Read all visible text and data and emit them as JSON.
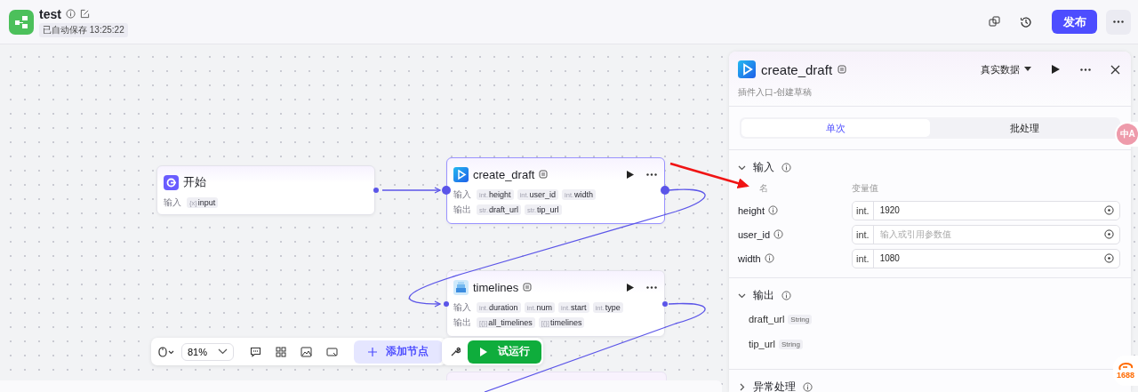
{
  "header": {
    "title": "test",
    "autosave": "已自动保存 13:25:22",
    "publish": "发布"
  },
  "nodes": [
    {
      "kind": "start",
      "title": "开始",
      "selected": false,
      "rows": [
        {
          "label": "输入",
          "params": [
            {
              "type": "{x}",
              "name": "input"
            }
          ]
        }
      ]
    },
    {
      "kind": "plugin",
      "title": "create_draft",
      "selected": true,
      "rows": [
        {
          "label": "输入",
          "params": [
            {
              "type": "int.",
              "name": "height"
            },
            {
              "type": "int.",
              "name": "user_id"
            },
            {
              "type": "int.",
              "name": "width"
            }
          ]
        },
        {
          "label": "输出",
          "params": [
            {
              "type": "str.",
              "name": "draft_url"
            },
            {
              "type": "str.",
              "name": "tip_url"
            }
          ]
        }
      ]
    },
    {
      "kind": "timeline",
      "title": "timelines",
      "selected": false,
      "rows": [
        {
          "label": "输入",
          "params": [
            {
              "type": "int.",
              "name": "duration"
            },
            {
              "type": "int.",
              "name": "num"
            },
            {
              "type": "int.",
              "name": "start"
            },
            {
              "type": "int.",
              "name": "type"
            }
          ]
        },
        {
          "label": "输出",
          "params": [
            {
              "type": "[{}]",
              "name": "all_timelines"
            },
            {
              "type": "[{}]",
              "name": "timelines"
            }
          ]
        }
      ]
    }
  ],
  "toolbar": {
    "zoom": "81%",
    "add_node": "添加节点",
    "run": "试运行"
  },
  "panel": {
    "title": "create_draft",
    "description": "插件入口-创建草稿",
    "data_source": "真实数据",
    "tabs": [
      {
        "label": "单次",
        "selected": true
      },
      {
        "label": "批处理",
        "selected": false
      }
    ],
    "input": {
      "title": "输入",
      "expanded": true,
      "name_header": "名",
      "value_header": "变量值",
      "rows": [
        {
          "name": "height",
          "type": "int.",
          "value": "1920"
        },
        {
          "name": "user_id",
          "type": "int.",
          "placeholder": "输入或引用参数值"
        },
        {
          "name": "width",
          "type": "int.",
          "value": "1080"
        }
      ]
    },
    "output": {
      "title": "输出",
      "expanded": true,
      "items": [
        {
          "name": "draft_url",
          "type": "String"
        },
        {
          "name": "tip_url",
          "type": "String"
        }
      ]
    },
    "error": {
      "title": "异常处理",
      "expanded": false
    }
  },
  "floating": {
    "translate": "中A",
    "logo": "1688"
  }
}
